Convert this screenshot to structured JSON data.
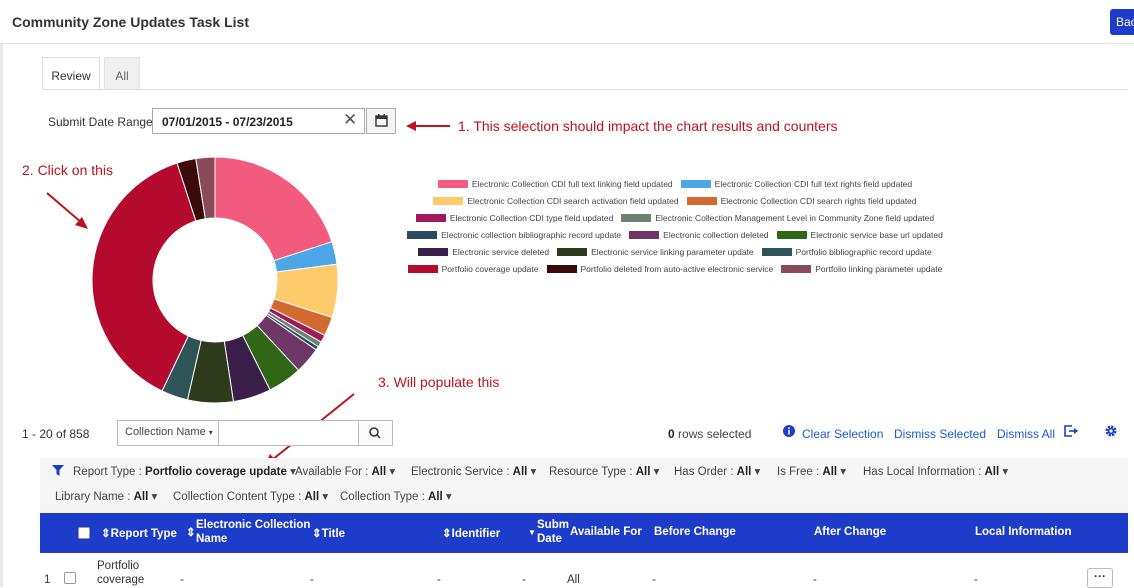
{
  "app": {
    "title": "Community Zone Updates Task List",
    "back_label": "Bac"
  },
  "tabs": [
    {
      "label": "Review",
      "active": true
    },
    {
      "label": "All",
      "active": false
    }
  ],
  "date_range": {
    "label": "Submit Date Range",
    "value": "07/01/2015 - 07/23/2015"
  },
  "annotations": {
    "a1": "1. This selection should impact the chart results and counters",
    "a2": "2. Click on this",
    "a3": "3. Will populate this"
  },
  "chart_data": {
    "type": "pie",
    "donut": true,
    "title": "",
    "slices": [
      {
        "label": "Electronic Collection CDI full text linking field updated",
        "value": 20,
        "color": "#f25b7d"
      },
      {
        "label": "Electronic Collection CDI full text rights field updated",
        "value": 3,
        "color": "#4da6e6"
      },
      {
        "label": "Electronic Collection CDI search activation field updated",
        "value": 7,
        "color": "#fdcb6b"
      },
      {
        "label": "Electronic Collection CDI search rights field updated",
        "value": 2.5,
        "color": "#d2692e"
      },
      {
        "label": "Electronic Collection CDI type field updated",
        "value": 1,
        "color": "#a0185a"
      },
      {
        "label": "Electronic Collection Management Level in Community Zone field updated",
        "value": 0.7,
        "color": "#6b8270"
      },
      {
        "label": "Electronic collection bibliographic record update",
        "value": 0.5,
        "color": "#2f4a63"
      },
      {
        "label": "Electronic collection deleted",
        "value": 3.5,
        "color": "#6e3768"
      },
      {
        "label": "Electronic service base url updated",
        "value": 4.5,
        "color": "#2f6717"
      },
      {
        "label": "Electronic service deleted",
        "value": 5,
        "color": "#3a1f4a"
      },
      {
        "label": "Electronic service linking parameter update",
        "value": 6,
        "color": "#2d3a1c"
      },
      {
        "label": "Portfolio bibliographic record update",
        "value": 3.5,
        "color": "#2e5457"
      },
      {
        "label": "Portfolio coverage update",
        "value": 38,
        "color": "#b40a2d"
      },
      {
        "label": "Portfolio deleted from auto-active electronic service",
        "value": 2.5,
        "color": "#3c0a0a"
      },
      {
        "label": "Portfolio linking parameter update",
        "value": 2.5,
        "color": "#8a4a5c"
      }
    ],
    "legend_placement": "right"
  },
  "legend_rows": [
    [
      0,
      1
    ],
    [
      2,
      3
    ],
    [
      4,
      5
    ],
    [
      6,
      7,
      8
    ],
    [
      9,
      10,
      11
    ],
    [
      12,
      13,
      14
    ]
  ],
  "list": {
    "counter": "1 - 20 of 858",
    "search_field": "Collection Name",
    "search_placeholder": "",
    "rows_selected_count": "0",
    "rows_selected_text": "rows selected",
    "clear_selection": "Clear Selection",
    "dismiss_selected": "Dismiss Selected",
    "dismiss_all": "Dismiss All"
  },
  "filters": [
    {
      "name": "Report Type",
      "value": "Portfolio coverage update"
    },
    {
      "name": "Available For",
      "value": "All"
    },
    {
      "name": "Electronic Service",
      "value": "All"
    },
    {
      "name": "Resource Type",
      "value": "All"
    },
    {
      "name": "Has Order",
      "value": "All"
    },
    {
      "name": "Is Free",
      "value": "All"
    },
    {
      "name": "Has Local Information",
      "value": "All"
    },
    {
      "name": "Library Name",
      "value": "All"
    },
    {
      "name": "Collection Content Type",
      "value": "All"
    },
    {
      "name": "Collection Type",
      "value": "All"
    }
  ],
  "table": {
    "headers": {
      "report_type": "Report Type",
      "collection_name_1": "Electronic Collection",
      "collection_name_2": "Name",
      "title": "Title",
      "identifier": "Identifier",
      "subm_1": "Subm",
      "subm_2": "Date",
      "available_for": "Available For",
      "before_change": "Before Change",
      "after_change": "After Change",
      "local_information": "Local Information"
    },
    "row1": {
      "index": "1",
      "report_type_1": "Portfolio",
      "report_type_2": "coverage",
      "collection_name": "-",
      "title": "-",
      "identifier": "-",
      "subm": "-",
      "available_for": "All",
      "before_change": "-",
      "after_change": "-",
      "local_information": "-"
    }
  }
}
